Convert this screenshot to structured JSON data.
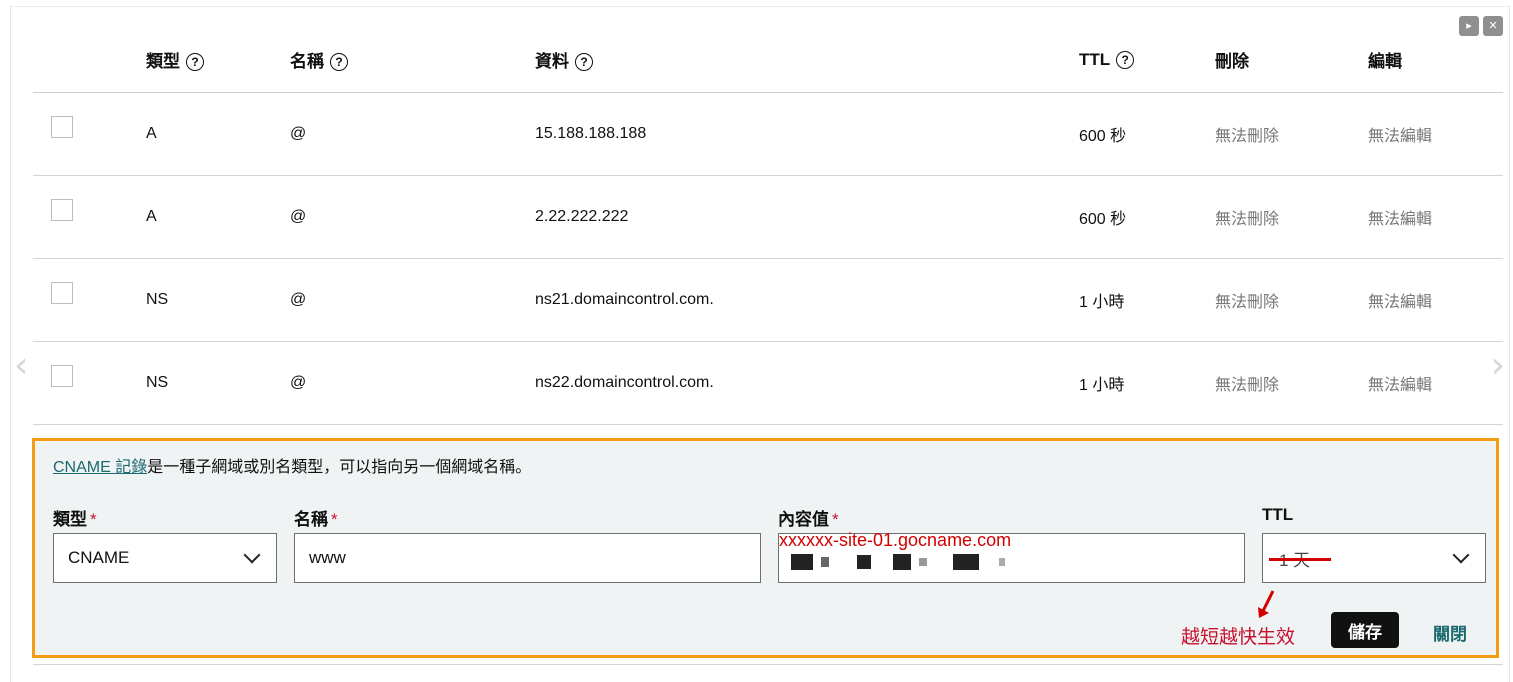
{
  "table": {
    "headers": {
      "type": "類型",
      "name": "名稱",
      "data": "資料",
      "ttl": "TTL",
      "delete": "刪除",
      "edit": "編輯"
    },
    "rows": [
      {
        "type": "A",
        "name": "@",
        "data": "15.188.188.188",
        "ttl": "600 秒",
        "delete": "無法刪除",
        "edit": "無法編輯"
      },
      {
        "type": "A",
        "name": "@",
        "data": "2.22.222.222",
        "ttl": "600 秒",
        "delete": "無法刪除",
        "edit": "無法編輯"
      },
      {
        "type": "NS",
        "name": "@",
        "data": "ns21.domaincontrol.com.",
        "ttl": "1 小時",
        "delete": "無法刪除",
        "edit": "無法編輯"
      },
      {
        "type": "NS",
        "name": "@",
        "data": "ns22.domaincontrol.com.",
        "ttl": "1 小時",
        "delete": "無法刪除",
        "edit": "無法編輯"
      }
    ]
  },
  "icons": {
    "help": "question-circle-icon",
    "chevron": "chevron-down-icon",
    "nav_prev": "chevron-left-icon",
    "nav_next": "chevron-right-icon",
    "play": "play-icon",
    "close": "close-icon"
  },
  "corner": {
    "play_glyph": "▸",
    "close_glyph": "✕"
  },
  "nav": {
    "prev_glyph": "‹",
    "next_glyph": "›"
  },
  "help_glyph": "?",
  "cname_form": {
    "description_link": "CNAME 記錄",
    "description_text": "是一種子網域或別名類型，可以指向另一個網域名稱。",
    "type_label": "類型",
    "type_value": "CNAME",
    "name_label": "名稱",
    "name_value": "www",
    "content_label": "內容值",
    "content_annotation": "xxxxxx-site-01.gocname.com",
    "ttl_label": "TTL",
    "ttl_value": "1 天",
    "required_mark": "*",
    "hint": "越短越快生效",
    "save_label": "儲存",
    "close_label": "關閉"
  },
  "colors": {
    "accent_border": "#f29d12",
    "annotation_red": "#d40000",
    "link_teal": "#1a6a6e",
    "save_button": "#111111",
    "panel_background": "#f0f3f4"
  }
}
